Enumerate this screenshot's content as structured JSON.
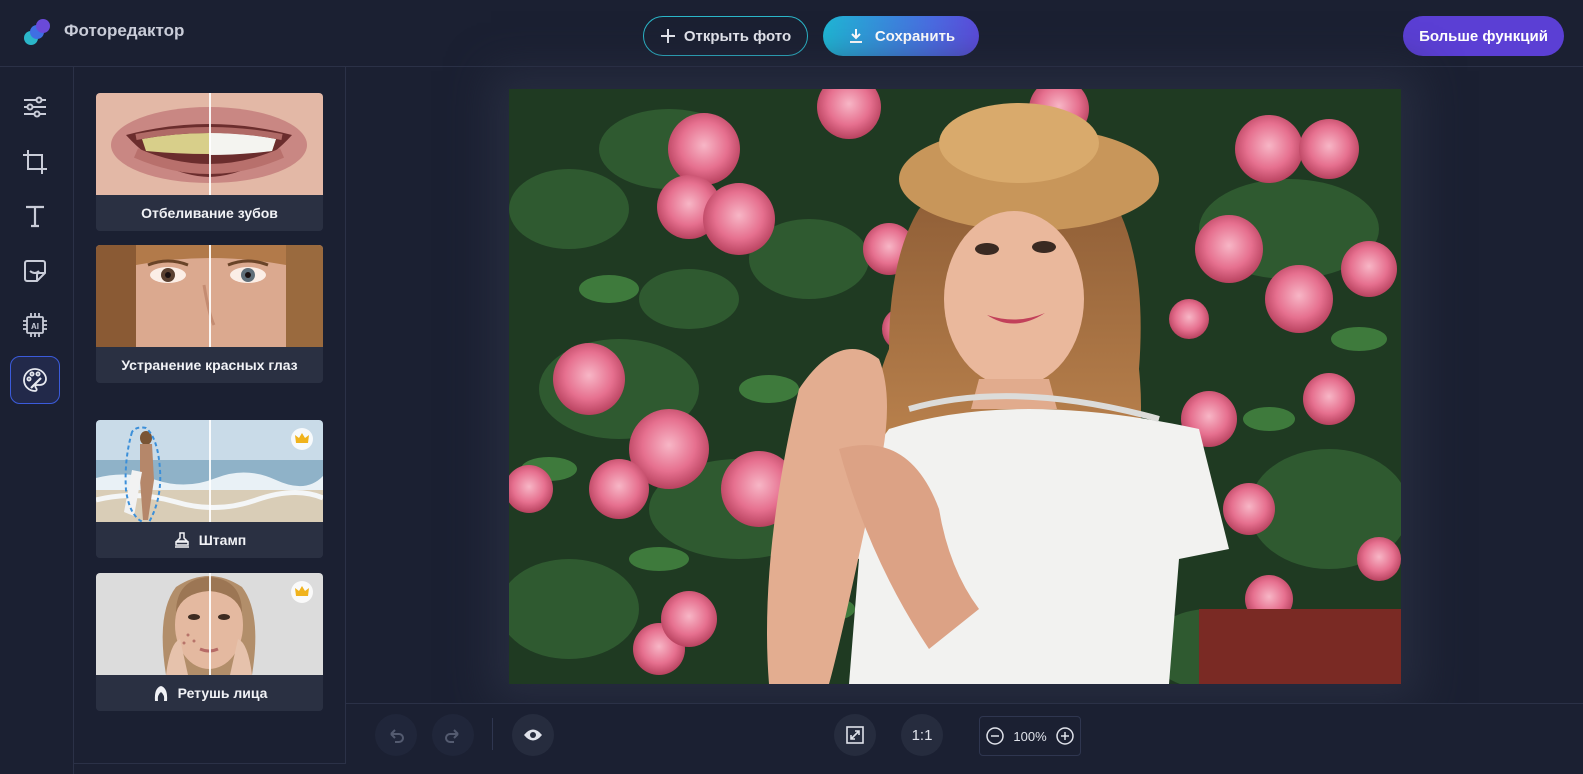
{
  "header": {
    "app_title": "Фоторедактор",
    "open_label": "Открыть фото",
    "save_label": "Сохранить",
    "more_label": "Больше функций"
  },
  "toolbar": {
    "items": [
      {
        "name": "adjustments",
        "icon": "sliders-icon"
      },
      {
        "name": "crop",
        "icon": "crop-icon"
      },
      {
        "name": "text",
        "icon": "text-icon"
      },
      {
        "name": "stickers",
        "icon": "sticker-icon"
      },
      {
        "name": "ai",
        "icon": "ai-chip-icon"
      },
      {
        "name": "retouch",
        "icon": "palette-icon",
        "active": true
      }
    ]
  },
  "panel": {
    "cards": [
      {
        "label": "Отбеливание зубов",
        "premium": false
      },
      {
        "label": "Устранение красных глаз",
        "premium": false
      },
      {
        "label": "Штамп",
        "icon": "stamp-icon",
        "premium": true
      },
      {
        "label": "Ретушь лица",
        "icon": "face-icon",
        "premium": true
      }
    ]
  },
  "bottombar": {
    "ratio_label": "1:1",
    "zoom_value": "100%"
  },
  "colors": {
    "background": "#1b2032",
    "accent_teal": "#2bb6c9",
    "accent_purple": "#5b3fd4"
  }
}
